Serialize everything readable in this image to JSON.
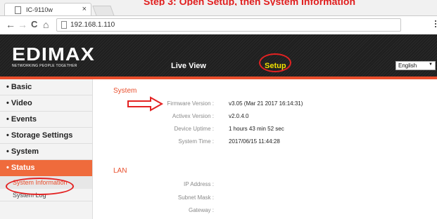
{
  "annotation": {
    "text": "Step 3: Open Setup, then System Information"
  },
  "browser": {
    "tab_title": "IC-9110w",
    "tab_close": "×",
    "url": "192.168.1.110",
    "back": "←",
    "forward": "→",
    "reload": "C",
    "home": "⌂"
  },
  "header": {
    "brand": "EDIMAX",
    "tagline": "NETWORKING PEOPLE TOGETHER",
    "nav": {
      "live_view": "Live View",
      "setup": "Setup"
    },
    "language": {
      "selected": "English",
      "caret": "▼"
    }
  },
  "sidebar": {
    "items": [
      {
        "label": "• Basic"
      },
      {
        "label": "• Video"
      },
      {
        "label": "• Events"
      },
      {
        "label": "• Storage Settings"
      },
      {
        "label": "• System"
      },
      {
        "label": "• Status"
      }
    ],
    "sub_items": [
      {
        "label": "System Information"
      },
      {
        "label": "System Log"
      }
    ]
  },
  "main": {
    "system": {
      "title": "System",
      "rows": [
        {
          "label": "Firmware Version :",
          "value": "v3.05 (Mar 21 2017 16:14:31)"
        },
        {
          "label": "Activex Version :",
          "value": "v2.0.4.0"
        },
        {
          "label": "Device Uptime :",
          "value": "1 hours 43 min 52 sec"
        },
        {
          "label": "System Time :",
          "value": "2017/06/15 11:44:28"
        }
      ]
    },
    "lan": {
      "title": "LAN",
      "rows": [
        {
          "label": "IP Address :",
          "value": ""
        },
        {
          "label": "Subnet Mask :",
          "value": ""
        },
        {
          "label": "Gateway :",
          "value": ""
        }
      ]
    }
  },
  "colors": {
    "accent": "#e94e2c",
    "setup_highlight": "#f2e200",
    "annotation_red": "#e32222"
  }
}
